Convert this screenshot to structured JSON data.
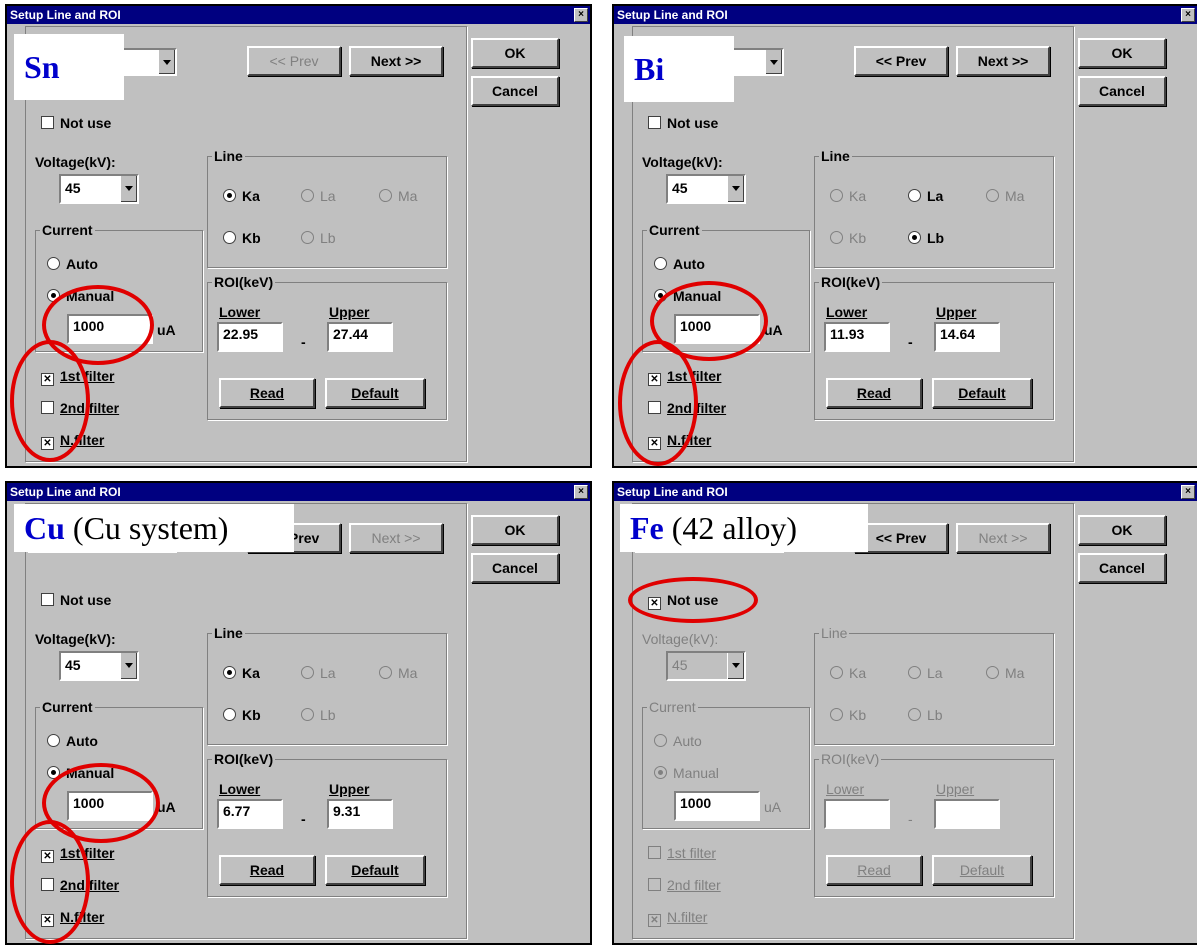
{
  "colors": {
    "titlebar": "#000080",
    "dialog": "#c0c0c0",
    "highlight": "#e00000",
    "element_label": "#0000cc"
  },
  "dialogs": [
    {
      "title": "Setup Line and ROI",
      "close_icon": "close-icon",
      "overlay": {
        "element": "Sn",
        "note": ""
      },
      "prev_label": "<< Prev",
      "next_label": "Next >>",
      "prev_enabled": false,
      "next_enabled": true,
      "ok_label": "OK",
      "cancel_label": "Cancel",
      "not_use_label": "Not use",
      "not_use_checked": false,
      "voltage_label": "Voltage(kV):",
      "voltage_value": "45",
      "current_label": "Current",
      "auto_label": "Auto",
      "manual_label": "Manual",
      "current_mode": "manual",
      "current_value": "1000",
      "current_unit": "uA",
      "filter1_label": "1st filter",
      "filter1_checked": true,
      "filter2_label": "2nd filter",
      "filter2_checked": false,
      "nfilter_label": "N.filter",
      "nfilter_checked": true,
      "line_label": "Line",
      "lines": {
        "Ka": "Ka",
        "La": "La",
        "Ma": "Ma",
        "Kb": "Kb",
        "Lb": "Lb"
      },
      "line_enabled": {
        "Ka": true,
        "La": false,
        "Ma": false,
        "Kb": true,
        "Lb": false
      },
      "line_selected": "Ka",
      "roi_label": "ROI(keV)",
      "lower_label": "Lower",
      "upper_label": "Upper",
      "lower_value": "22.95",
      "upper_value": "27.44",
      "read_label": "Read",
      "default_label": "Default",
      "disabled": false
    },
    {
      "title": "Setup Line and ROI",
      "close_icon": "close-icon",
      "overlay": {
        "element": "Bi",
        "note": ""
      },
      "prev_label": "<< Prev",
      "next_label": "Next >>",
      "prev_enabled": true,
      "next_enabled": true,
      "ok_label": "OK",
      "cancel_label": "Cancel",
      "not_use_label": "Not use",
      "not_use_checked": false,
      "voltage_label": "Voltage(kV):",
      "voltage_value": "45",
      "current_label": "Current",
      "auto_label": "Auto",
      "manual_label": "Manual",
      "current_mode": "manual",
      "current_value": "1000",
      "current_unit": "uA",
      "filter1_label": "1st filter",
      "filter1_checked": true,
      "filter2_label": "2nd filter",
      "filter2_checked": false,
      "nfilter_label": "N.filter",
      "nfilter_checked": true,
      "line_label": "Line",
      "lines": {
        "Ka": "Ka",
        "La": "La",
        "Ma": "Ma",
        "Kb": "Kb",
        "Lb": "Lb"
      },
      "line_enabled": {
        "Ka": false,
        "La": true,
        "Ma": false,
        "Kb": false,
        "Lb": true
      },
      "line_selected": "Lb",
      "roi_label": "ROI(keV)",
      "lower_label": "Lower",
      "upper_label": "Upper",
      "lower_value": "11.93",
      "upper_value": "14.64",
      "read_label": "Read",
      "default_label": "Default",
      "disabled": false
    },
    {
      "title": "Setup Line and ROI",
      "close_icon": "close-icon",
      "overlay": {
        "element": "Cu",
        "note": " (Cu system)"
      },
      "prev_label": "<< Prev",
      "next_label": "Next >>",
      "prev_enabled": true,
      "next_enabled": false,
      "ok_label": "OK",
      "cancel_label": "Cancel",
      "not_use_label": "Not use",
      "not_use_checked": false,
      "voltage_label": "Voltage(kV):",
      "voltage_value": "45",
      "current_label": "Current",
      "auto_label": "Auto",
      "manual_label": "Manual",
      "current_mode": "manual",
      "current_value": "1000",
      "current_unit": "uA",
      "filter1_label": "1st filter",
      "filter1_checked": true,
      "filter2_label": "2nd filter",
      "filter2_checked": false,
      "nfilter_label": "N.filter",
      "nfilter_checked": true,
      "line_label": "Line",
      "lines": {
        "Ka": "Ka",
        "La": "La",
        "Ma": "Ma",
        "Kb": "Kb",
        "Lb": "Lb"
      },
      "line_enabled": {
        "Ka": true,
        "La": false,
        "Ma": false,
        "Kb": true,
        "Lb": false
      },
      "line_selected": "Ka",
      "roi_label": "ROI(keV)",
      "lower_label": "Lower",
      "upper_label": "Upper",
      "lower_value": "6.77",
      "upper_value": "9.31",
      "read_label": "Read",
      "default_label": "Default",
      "disabled": false
    },
    {
      "title": "Setup Line and ROI",
      "close_icon": "close-icon",
      "overlay": {
        "element": "Fe",
        "note": " (42 alloy)"
      },
      "prev_label": "<< Prev",
      "next_label": "Next >>",
      "prev_enabled": true,
      "next_enabled": false,
      "ok_label": "OK",
      "cancel_label": "Cancel",
      "not_use_label": "Not use",
      "not_use_checked": true,
      "voltage_label": "Voltage(kV):",
      "voltage_value": "45",
      "current_label": "Current",
      "auto_label": "Auto",
      "manual_label": "Manual",
      "current_mode": "manual",
      "current_value": "1000",
      "current_unit": "uA",
      "filter1_label": "1st filter",
      "filter1_checked": false,
      "filter2_label": "2nd filter",
      "filter2_checked": false,
      "nfilter_label": "N.filter",
      "nfilter_checked": true,
      "line_label": "Line",
      "lines": {
        "Ka": "Ka",
        "La": "La",
        "Ma": "Ma",
        "Kb": "Kb",
        "Lb": "Lb"
      },
      "line_enabled": {
        "Ka": false,
        "La": false,
        "Ma": false,
        "Kb": false,
        "Lb": false
      },
      "line_selected": "",
      "roi_label": "ROI(keV)",
      "lower_label": "Lower",
      "upper_label": "Upper",
      "lower_value": "",
      "upper_value": "",
      "read_label": "Read",
      "default_label": "Default",
      "disabled": true
    }
  ]
}
